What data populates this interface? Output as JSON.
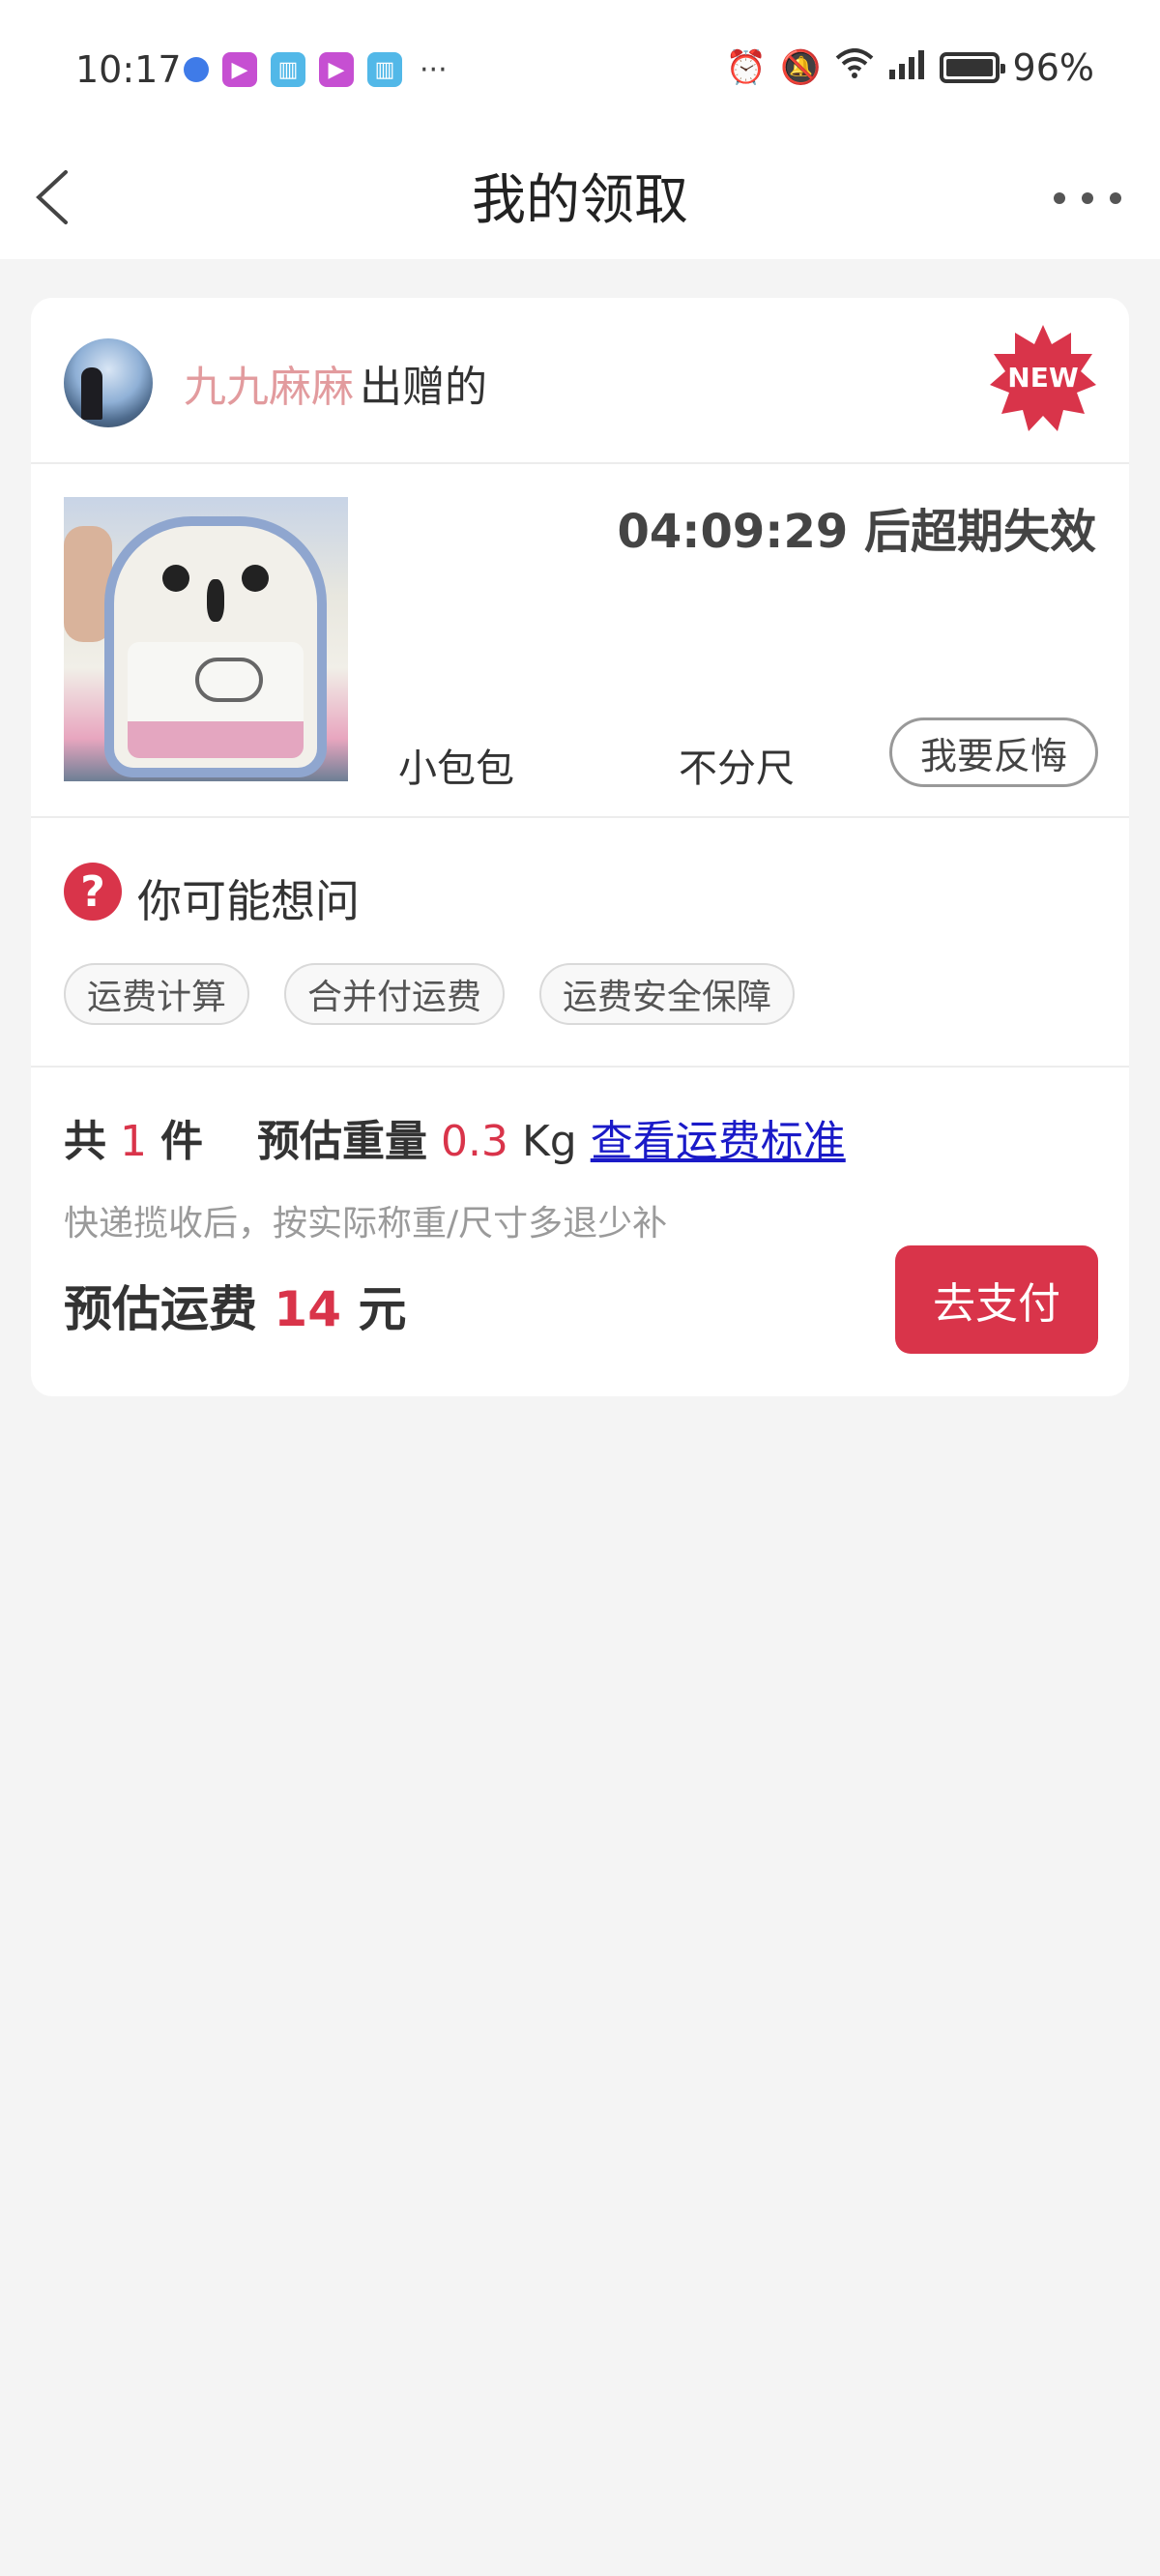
{
  "status_bar": {
    "time": "10:17",
    "more": "···",
    "battery": "96%",
    "icons": [
      "app-dot-icon",
      "video-icon",
      "book-icon",
      "video-icon",
      "book-icon",
      "alarm-icon",
      "mute-icon",
      "wifi-icon",
      "signal-icon",
      "battery-icon"
    ]
  },
  "nav": {
    "title": "我的领取"
  },
  "gift": {
    "giver_name": "九九麻麻",
    "giver_suffix": "出赠的",
    "badge": "NEW",
    "expire_text": "04:09:29 后超期失效",
    "item_name": "小包包",
    "item_size": "不分尺",
    "regret_label": "我要反悔"
  },
  "faq": {
    "title": "你可能想问",
    "chips": [
      "运费计算",
      "合并付运费",
      "运费安全保障"
    ]
  },
  "summary": {
    "count_prefix": "共",
    "count": "1",
    "count_suffix": "件",
    "weight_label": "预估重量",
    "weight_value": "0.3",
    "weight_unit": "Kg",
    "standard_link": "查看运费标准",
    "note": "快递揽收后，按实际称重/尺寸多退少补",
    "fee_label": "预估运费",
    "fee_value": "14",
    "fee_unit": "元",
    "pay_label": "去支付"
  },
  "colors": {
    "accent_red": "#d9344a",
    "giver_pink": "#e29b9e",
    "link_blue": "#1a1ac8",
    "background": "#f4f4f4"
  }
}
